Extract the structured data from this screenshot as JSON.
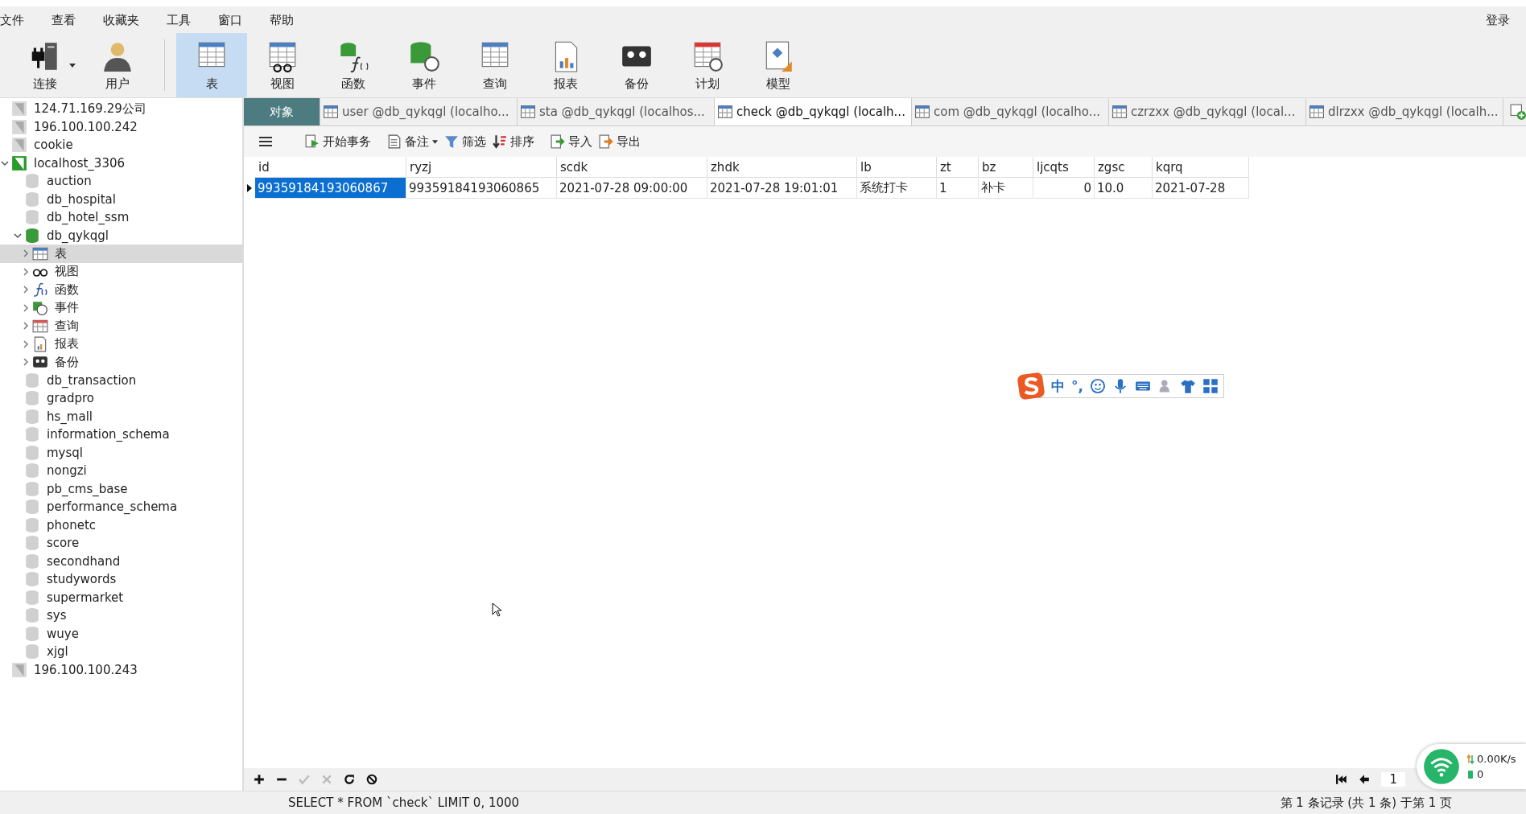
{
  "menu": [
    "文件",
    "查看",
    "收藏夹",
    "工具",
    "窗口",
    "帮助"
  ],
  "login": "登录",
  "toolbar": [
    {
      "label": "连接",
      "kind": "connection",
      "selected": false,
      "dropdown": true
    },
    {
      "label": "用户",
      "kind": "user",
      "selected": false,
      "dropdown": false
    },
    {
      "label": "表",
      "kind": "table",
      "selected": true,
      "dropdown": false
    },
    {
      "label": "视图",
      "kind": "view",
      "selected": false,
      "dropdown": false
    },
    {
      "label": "函数",
      "kind": "function",
      "selected": false,
      "dropdown": false
    },
    {
      "label": "事件",
      "kind": "event",
      "selected": false,
      "dropdown": false
    },
    {
      "label": "查询",
      "kind": "query",
      "selected": false,
      "dropdown": false
    },
    {
      "label": "报表",
      "kind": "report",
      "selected": false,
      "dropdown": false
    },
    {
      "label": "备份",
      "kind": "backup",
      "selected": false,
      "dropdown": false
    },
    {
      "label": "计划",
      "kind": "schedule",
      "selected": false,
      "dropdown": false
    },
    {
      "label": "模型",
      "kind": "model",
      "selected": false,
      "dropdown": false
    }
  ],
  "tree": [
    {
      "label": "124.71.169.29公司",
      "kind": "connection",
      "connected": false,
      "selected": false
    },
    {
      "label": "196.100.100.242",
      "kind": "connection",
      "connected": false,
      "selected": false
    },
    {
      "label": "cookie",
      "kind": "connection",
      "connected": false,
      "selected": false
    },
    {
      "label": "localhost_3306",
      "kind": "connection",
      "connected": true,
      "selected": false,
      "expanded": true,
      "children": [
        {
          "label": "auction",
          "kind": "database",
          "connected": false,
          "selected": false
        },
        {
          "label": "db_hospital",
          "kind": "database",
          "connected": false,
          "selected": false
        },
        {
          "label": "db_hotel_ssm",
          "kind": "database",
          "connected": false,
          "selected": false
        },
        {
          "label": "db_qykqgl",
          "kind": "database",
          "connected": true,
          "selected": false,
          "expanded": true,
          "children": [
            {
              "label": "表",
              "kind": "table",
              "selected": true,
              "expanded": false
            },
            {
              "label": "视图",
              "kind": "view",
              "selected": false,
              "expanded": false
            },
            {
              "label": "函数",
              "kind": "function",
              "selected": false,
              "expanded": false
            },
            {
              "label": "事件",
              "kind": "event",
              "selected": false,
              "expanded": false
            },
            {
              "label": "查询",
              "kind": "query",
              "selected": false,
              "expanded": false
            },
            {
              "label": "报表",
              "kind": "report",
              "selected": false,
              "expanded": false
            },
            {
              "label": "备份",
              "kind": "backup",
              "selected": false,
              "expanded": false
            }
          ]
        },
        {
          "label": "db_transaction",
          "kind": "database",
          "connected": false,
          "selected": false
        },
        {
          "label": "gradpro",
          "kind": "database",
          "connected": false,
          "selected": false
        },
        {
          "label": "hs_mall",
          "kind": "database",
          "connected": false,
          "selected": false
        },
        {
          "label": "information_schema",
          "kind": "database",
          "connected": false,
          "selected": false
        },
        {
          "label": "mysql",
          "kind": "database",
          "connected": false,
          "selected": false
        },
        {
          "label": "nongzi",
          "kind": "database",
          "connected": false,
          "selected": false
        },
        {
          "label": "pb_cms_base",
          "kind": "database",
          "connected": false,
          "selected": false
        },
        {
          "label": "performance_schema",
          "kind": "database",
          "connected": false,
          "selected": false
        },
        {
          "label": "phonetc",
          "kind": "database",
          "connected": false,
          "selected": false
        },
        {
          "label": "score",
          "kind": "database",
          "connected": false,
          "selected": false
        },
        {
          "label": "secondhand",
          "kind": "database",
          "connected": false,
          "selected": false
        },
        {
          "label": "studywords",
          "kind": "database",
          "connected": false,
          "selected": false
        },
        {
          "label": "supermarket",
          "kind": "database",
          "connected": false,
          "selected": false
        },
        {
          "label": "sys",
          "kind": "database",
          "connected": false,
          "selected": false
        },
        {
          "label": "wuye",
          "kind": "database",
          "connected": false,
          "selected": false
        },
        {
          "label": "xjgl",
          "kind": "database",
          "connected": false,
          "selected": false
        }
      ]
    },
    {
      "label": "196.100.100.243",
      "kind": "connection",
      "connected": false,
      "selected": false
    }
  ],
  "tabs": [
    {
      "label": "对象",
      "kind": "object",
      "selected": false
    },
    {
      "label": "user @db_qykqgl (localho...",
      "kind": "table",
      "selected": false
    },
    {
      "label": "sta @db_qykqgl (localhos...",
      "kind": "table",
      "selected": false
    },
    {
      "label": "check @db_qykqgl (localh...",
      "kind": "table",
      "selected": true
    },
    {
      "label": "com @db_qykqgl (localho...",
      "kind": "table",
      "selected": false
    },
    {
      "label": "czrzxx @db_qykqgl (local...",
      "kind": "table",
      "selected": false
    },
    {
      "label": "dlrzxx @db_qykqgl (localh...",
      "kind": "table",
      "selected": false
    }
  ],
  "object_toolbar": [
    {
      "label": "开始事务",
      "kind": "transaction"
    },
    {
      "label": "备注",
      "kind": "note",
      "dropdown": true
    },
    {
      "label": "筛选",
      "kind": "filter"
    },
    {
      "label": "排序",
      "kind": "sort"
    },
    {
      "label": "导入",
      "kind": "import"
    },
    {
      "label": "导出",
      "kind": "export"
    }
  ],
  "grid": {
    "columns": [
      {
        "name": "id",
        "numeric": false
      },
      {
        "name": "ryzj",
        "numeric": false
      },
      {
        "name": "scdk",
        "numeric": false
      },
      {
        "name": "zhdk",
        "numeric": false
      },
      {
        "name": "lb",
        "numeric": false
      },
      {
        "name": "zt",
        "numeric": false
      },
      {
        "name": "bz",
        "numeric": false
      },
      {
        "name": "ljcqts",
        "numeric": true
      },
      {
        "name": "zgsc",
        "numeric": false
      },
      {
        "name": "kqrq",
        "numeric": false
      }
    ],
    "rows": [
      {
        "current": true,
        "cells": [
          {
            "value": "99359184193060867",
            "selected": true
          },
          {
            "value": "99359184193060865",
            "selected": false
          },
          {
            "value": "2021-07-28 09:00:00",
            "selected": false
          },
          {
            "value": "2021-07-28 19:01:01",
            "selected": false
          },
          {
            "value": "系统打卡",
            "selected": false
          },
          {
            "value": "1",
            "selected": false
          },
          {
            "value": "补卡",
            "selected": false
          },
          {
            "value": "0",
            "selected": false
          },
          {
            "value": "10.0",
            "selected": false
          },
          {
            "value": "2021-07-28",
            "selected": false
          }
        ]
      }
    ]
  },
  "ime": {
    "chars": [
      "中",
      "°,"
    ]
  },
  "network": {
    "speed": "0.00K/s",
    "count": "0"
  },
  "pager": {
    "page": "1"
  },
  "status": {
    "sql": "SELECT * FROM `check` LIMIT 0, 1000",
    "records": "第 1 条记录 (共 1 条) 于第 1 页"
  }
}
